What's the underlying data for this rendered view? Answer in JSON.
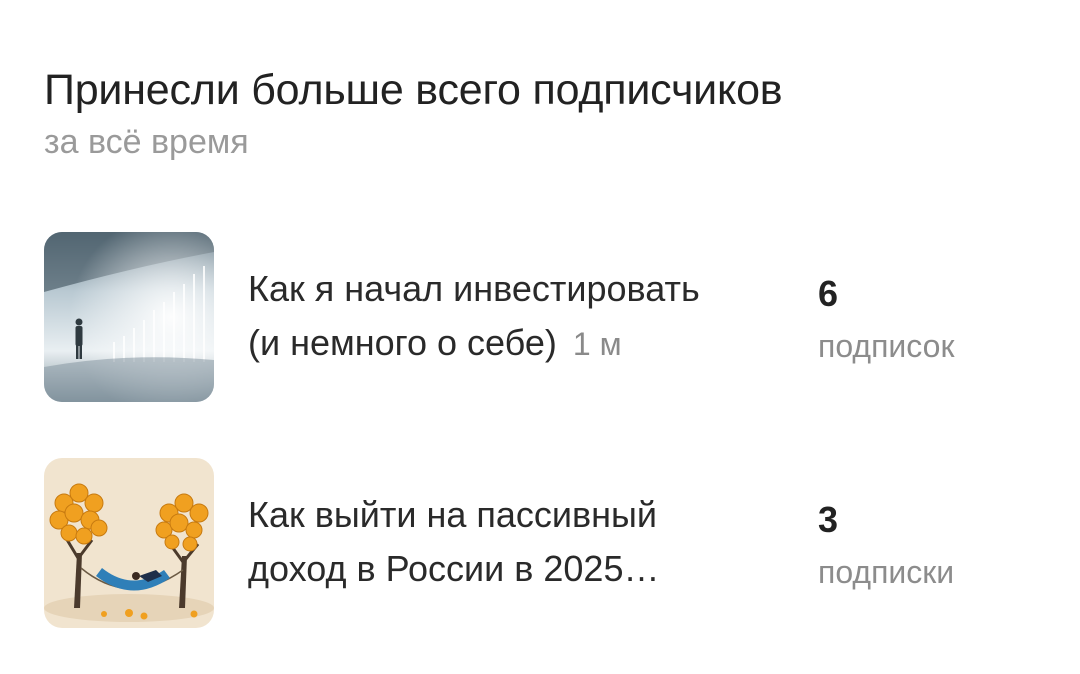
{
  "section": {
    "title": "Принесли больше всего подписчиков",
    "subtitle": "за всё время"
  },
  "items": [
    {
      "title_line1": "Как я начал инвестировать",
      "title_line2": "(и немного о себе)",
      "meta": "1 м",
      "count": "6",
      "count_label": "подписок",
      "thumbnail": "person-facing-glowing-chart-image"
    },
    {
      "title_line1": "Как выйти на пассивный",
      "title_line2": "доход в России в 2025…",
      "count": "3",
      "count_label": "подписки",
      "thumbnail": "hammock-money-trees-image"
    }
  ]
}
